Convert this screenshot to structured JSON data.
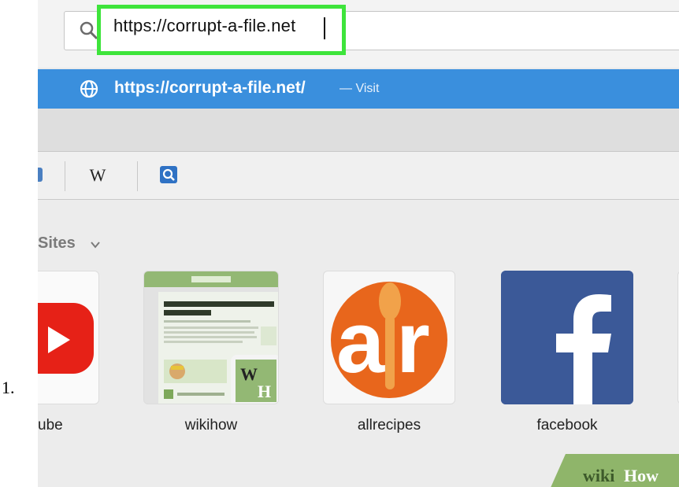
{
  "step_number": "1.",
  "address_bar": {
    "value": "https://corrupt-a-file.net",
    "search_icon": "search-icon"
  },
  "suggestion": {
    "url": "https://corrupt-a-file.net/",
    "action": "— Visit",
    "icon": "globe-icon"
  },
  "search_engines": {
    "items": [
      {
        "name": "wikipedia",
        "glyph": "W"
      },
      {
        "name": "search",
        "icon": "search-icon"
      }
    ]
  },
  "top_sites": {
    "label": "Sites",
    "tiles": [
      {
        "label": "ube",
        "icon": "youtube-logo"
      },
      {
        "label": "wikihow",
        "icon": "wikihow-thumbnail",
        "thumb_title": "How to Order Groceries from Android"
      },
      {
        "label": "allrecipes",
        "icon": "allrecipes-logo",
        "logo_text": "ar"
      },
      {
        "label": "facebook",
        "icon": "facebook-logo",
        "logo_text": "f"
      }
    ]
  },
  "watermark": {
    "prefix": "wiki",
    "suffix": "How"
  },
  "colors": {
    "highlight": "#3ee43b",
    "suggestion_bg": "#3a8fdd",
    "youtube_red": "#e62117",
    "allrecipes_orange": "#e8661c",
    "facebook_blue": "#3b5998",
    "wikihow_green": "#93b874"
  }
}
